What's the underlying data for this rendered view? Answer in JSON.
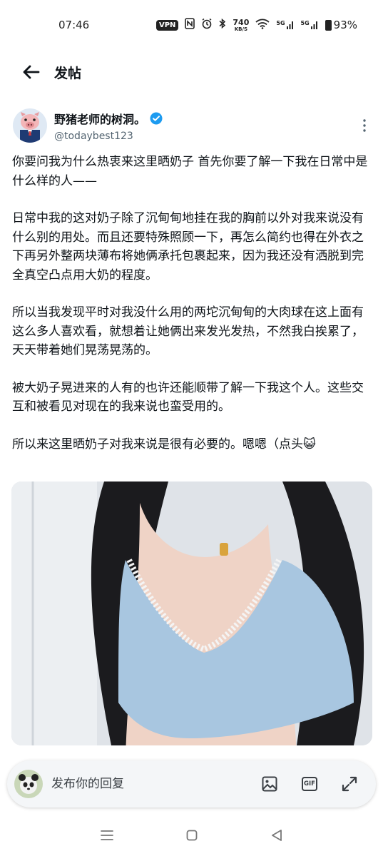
{
  "status_bar": {
    "time": "07:46",
    "vpn": "VPN",
    "net_speed_value": "740",
    "net_speed_unit": "KB/S",
    "signal_1": "5G",
    "signal_2": "5G",
    "battery": "93%"
  },
  "header": {
    "title": "发帖",
    "back_icon": "arrow-left-icon"
  },
  "post": {
    "author_name": "野猪老师的树洞。",
    "verified_icon": "verified-badge-icon",
    "handle": "@todaybest123",
    "paragraphs": [
      "你要问我为什么热衷来这里晒奶子 首先你要了解一下我在日常中是什么样的人——",
      "日常中我的这对奶子除了沉甸甸地挂在我的胸前以外对我来说没有什么别的用处。而且还要特殊照顾一下，再怎么简约也得在外衣之下再另外整两块薄布将她俩承托包裹起来，因为我还没有洒脱到完全真空凸点用大奶的程度。",
      "所以当我发现平时对我没什么用的两坨沉甸甸的大肉球在这上面有这么多人喜欢看，就想着让她俩出来发光发热，不然我白挨累了，天天带着她们晃荡晃荡的。",
      "被大奶子晃进来的人有的也许还能顺带了解一下我这个人。这些交互和被看见对现在的我来说也蛮受用的。",
      "所以来这里晒奶子对我来说是很有必要的。嗯嗯（点头😺"
    ]
  },
  "reply": {
    "placeholder": "发布你的回复",
    "image_icon": "image-icon",
    "gif_label": "GIF",
    "expand_icon": "expand-icon"
  },
  "colors": {
    "verified": "#1d9bf0",
    "text": "#0f1419",
    "secondary": "#536471"
  }
}
